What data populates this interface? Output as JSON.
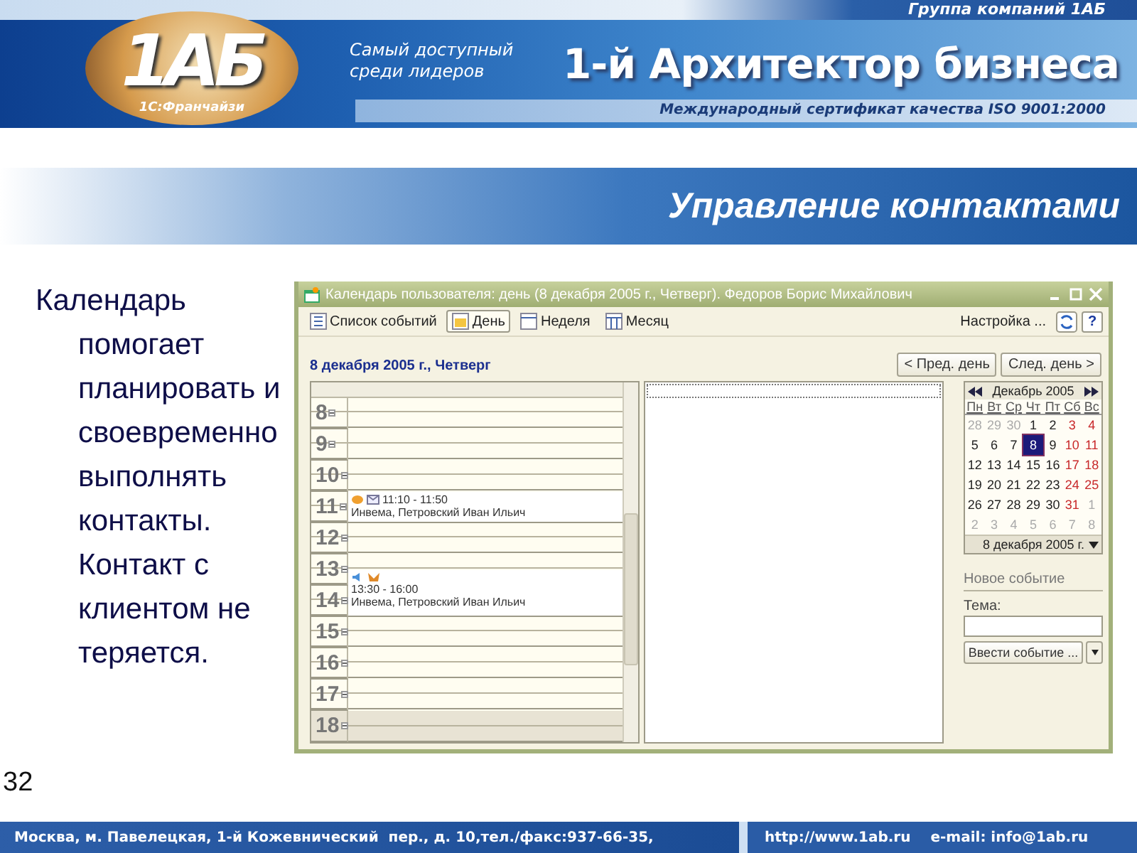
{
  "banner": {
    "group": "Группа компаний 1АБ",
    "logo": "1АБ",
    "logo_caption": "1С:Франчайзи",
    "slogan": "Самый доступный среди лидеров",
    "headline": "1-й Архитектор бизнеса",
    "certificate": "Международный сертификат качества ISO 9001:2000"
  },
  "slide_title": "Управление контактами",
  "body_text": "Календарь помогает планировать и своевременно выполнять контакты. Контакт с клиентом не теряется.",
  "window": {
    "title": "Календарь пользователя: день (8 декабря 2005 г., Четверг). Федоров Борис Михайлович",
    "toolbar": [
      {
        "label": "Список событий",
        "selected": false
      },
      {
        "label": "День",
        "selected": true
      },
      {
        "label": "Неделя",
        "selected": false
      },
      {
        "label": "Месяц",
        "selected": false
      }
    ],
    "settings": "Настройка ...",
    "help": "?",
    "date_heading": "8 декабря 2005 г., Четверг",
    "nav_buttons": [
      "< Пред. день",
      "След. день >"
    ],
    "hours": [
      {
        "hour": "8",
        "working": true
      },
      {
        "hour": "9",
        "working": true
      },
      {
        "hour": "10",
        "working": true
      },
      {
        "hour": "11",
        "working": true,
        "events": [
          {
            "kind": "single",
            "time": "11:10 - 11:50",
            "subject": "Инвема, Петровский Иван Ильич"
          }
        ]
      },
      {
        "hour": "12",
        "working": true
      },
      {
        "hour": "13",
        "working": true,
        "events": [
          {
            "kind": "double",
            "time": "13:30 - 16:00",
            "subject": "Инвема, Петровский Иван Ильич"
          }
        ]
      },
      {
        "hour": "14",
        "working": true
      },
      {
        "hour": "15",
        "working": true
      },
      {
        "hour": "16",
        "working": true
      },
      {
        "hour": "17",
        "working": true
      },
      {
        "hour": "18",
        "working": false
      }
    ],
    "calendar": {
      "month": "Декабрь 2005",
      "weekdays": [
        "Пн",
        "Вт",
        "Ср",
        "Чт",
        "Пт",
        "Сб",
        "Вс"
      ],
      "weeks": [
        [
          {
            "day": "28",
            "kind": "other",
            "selected": false
          },
          {
            "day": "29",
            "kind": "other",
            "selected": false
          },
          {
            "day": "30",
            "kind": "other",
            "selected": false
          },
          {
            "day": "1",
            "kind": "day",
            "selected": false
          },
          {
            "day": "2",
            "kind": "day",
            "selected": false
          },
          {
            "day": "3",
            "kind": "weekend",
            "selected": false
          },
          {
            "day": "4",
            "kind": "weekend",
            "selected": false
          }
        ],
        [
          {
            "day": "5",
            "kind": "day",
            "selected": false
          },
          {
            "day": "6",
            "kind": "day",
            "selected": false
          },
          {
            "day": "7",
            "kind": "day",
            "selected": false
          },
          {
            "day": "8",
            "kind": "day",
            "selected": true
          },
          {
            "day": "9",
            "kind": "day",
            "selected": false
          },
          {
            "day": "10",
            "kind": "weekend",
            "selected": false
          },
          {
            "day": "11",
            "kind": "weekend",
            "selected": false
          }
        ],
        [
          {
            "day": "12",
            "kind": "day",
            "selected": false
          },
          {
            "day": "13",
            "kind": "day",
            "selected": false
          },
          {
            "day": "14",
            "kind": "day",
            "selected": false
          },
          {
            "day": "15",
            "kind": "day",
            "selected": false
          },
          {
            "day": "16",
            "kind": "day",
            "selected": false
          },
          {
            "day": "17",
            "kind": "weekend",
            "selected": false
          },
          {
            "day": "18",
            "kind": "weekend",
            "selected": false
          }
        ],
        [
          {
            "day": "19",
            "kind": "day",
            "selected": false
          },
          {
            "day": "20",
            "kind": "day",
            "selected": false
          },
          {
            "day": "21",
            "kind": "day",
            "selected": false
          },
          {
            "day": "22",
            "kind": "day",
            "selected": false
          },
          {
            "day": "23",
            "kind": "day",
            "selected": false
          },
          {
            "day": "24",
            "kind": "weekend",
            "selected": false
          },
          {
            "day": "25",
            "kind": "weekend",
            "selected": false
          }
        ],
        [
          {
            "day": "26",
            "kind": "day",
            "selected": false
          },
          {
            "day": "27",
            "kind": "day",
            "selected": false
          },
          {
            "day": "28",
            "kind": "day",
            "selected": false
          },
          {
            "day": "29",
            "kind": "day",
            "selected": false
          },
          {
            "day": "30",
            "kind": "day",
            "selected": false
          },
          {
            "day": "31",
            "kind": "weekend",
            "selected": false
          },
          {
            "day": "1",
            "kind": "other",
            "selected": false
          }
        ],
        [
          {
            "day": "2",
            "kind": "other",
            "selected": false
          },
          {
            "day": "3",
            "kind": "other",
            "selected": false
          },
          {
            "day": "4",
            "kind": "other",
            "selected": false
          },
          {
            "day": "5",
            "kind": "other",
            "selected": false
          },
          {
            "day": "6",
            "kind": "other",
            "selected": false
          },
          {
            "day": "7",
            "kind": "other",
            "selected": false
          },
          {
            "day": "8",
            "kind": "other",
            "selected": false
          }
        ]
      ],
      "footer": "8 декабря 2005 г."
    },
    "new_event": {
      "heading": "Новое событие",
      "subject_label": "Тема:",
      "create_button": "Ввести событие ..."
    }
  },
  "page_number": "32",
  "footer": {
    "address": "Москва, м. Павелецкая, 1-й Кожевнический  пер., д. 10,тел./факс:937-66-35,",
    "website": "http://www.1ab.ru",
    "email": "e-mail: info@1ab.ru"
  }
}
